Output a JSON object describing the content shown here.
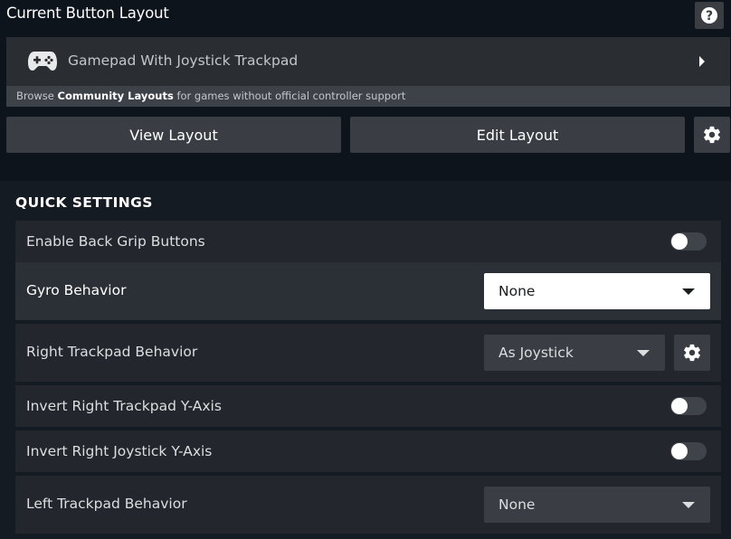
{
  "header": {
    "title": "Current Button Layout",
    "help_glyph": "?"
  },
  "layout": {
    "name": "Gamepad With Joystick Trackpad",
    "icon": "gamepad-icon",
    "browse_prefix": "Browse ",
    "browse_link": "Community Layouts",
    "browse_suffix": " for games without official controller support"
  },
  "buttons": {
    "view_label": "View Layout",
    "edit_label": "Edit Layout",
    "settings_icon": "gear-icon"
  },
  "quick_settings": {
    "heading": "QUICK SETTINGS",
    "rows": [
      {
        "label": "Enable Back Grip Buttons",
        "control": "toggle",
        "on": false
      },
      {
        "label": "Gyro Behavior",
        "control": "dropdown",
        "value": "None",
        "focused": true
      },
      {
        "label": "Right Trackpad Behavior",
        "control": "dropdown",
        "value": "As Joystick",
        "has_settings": true
      },
      {
        "label": "Invert Right Trackpad Y-Axis",
        "control": "toggle",
        "on": false
      },
      {
        "label": "Invert Right Joystick Y-Axis",
        "control": "toggle",
        "on": false
      },
      {
        "label": "Left Trackpad Behavior",
        "control": "dropdown",
        "value": "None"
      }
    ]
  },
  "colors": {
    "background": "#0e141b",
    "panel": "#151b23",
    "row": "#23272d",
    "button": "#3a3e44",
    "focus_white": "#ffffff"
  }
}
